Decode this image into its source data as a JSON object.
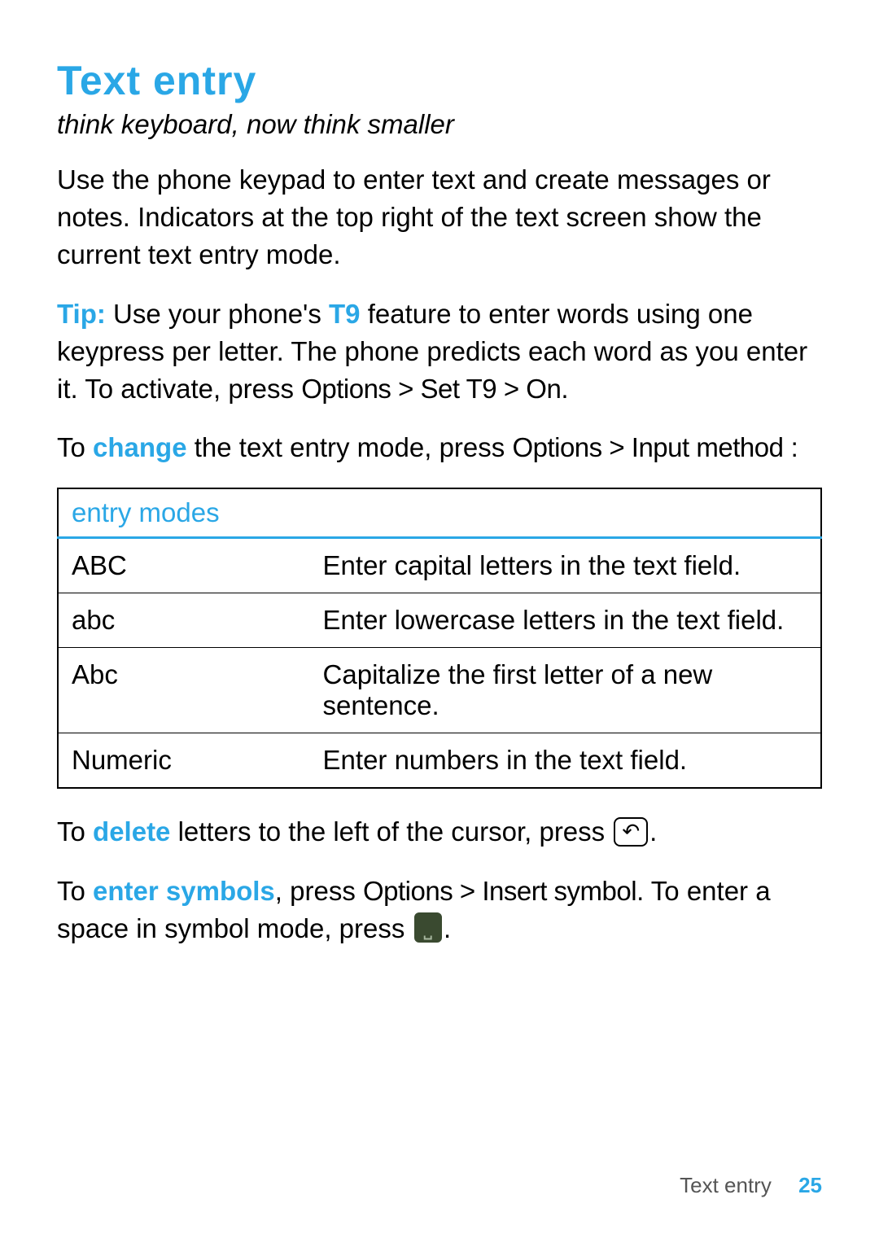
{
  "heading": "Text entry",
  "tagline": "think keyboard, now think smaller",
  "intro": "Use the phone keypad to enter text and create messages or notes. Indicators at the top right of the text screen show the current text entry mode.",
  "tip": {
    "label": "Tip:",
    "part1": " Use your phone's ",
    "t9": "T9",
    "part2": " feature to enter words using one keypress per letter. The phone predicts each word as you enter it. To activate, press ",
    "menu1": "Options",
    "sep1": " > ",
    "menu2": "Set T9",
    "sep2": " > ",
    "menu3": "On",
    "end": "."
  },
  "change": {
    "part1": "To ",
    "kw": "change",
    "part2": " the text entry mode, press ",
    "menu1": "Options",
    "sep1": " > ",
    "menu2": "Input method",
    "end": " :"
  },
  "table": {
    "header": "entry modes",
    "rows": [
      {
        "mode": "ABC",
        "desc": "Enter capital letters in the text field."
      },
      {
        "mode": "abc",
        "desc": "Enter lowercase letters in the text field."
      },
      {
        "mode": "Abc",
        "desc": "Capitalize the first letter of a new sentence."
      },
      {
        "mode": "Numeric",
        "desc": "Enter numbers in the text field."
      }
    ]
  },
  "delete": {
    "part1": "To ",
    "kw": "delete",
    "part2": " letters to the left of the cursor, press ",
    "key_glyph": "↶",
    "end": "."
  },
  "symbols": {
    "part1": "To ",
    "kw": "enter symbols",
    "part2": ", press ",
    "menu1": "Options",
    "sep1": " > ",
    "menu2": "Insert symbol",
    "part3": ". To enter a space in symbol mode, press ",
    "key_glyph": "⎵",
    "end": "."
  },
  "footer": {
    "section": "Text entry",
    "page": "25"
  }
}
